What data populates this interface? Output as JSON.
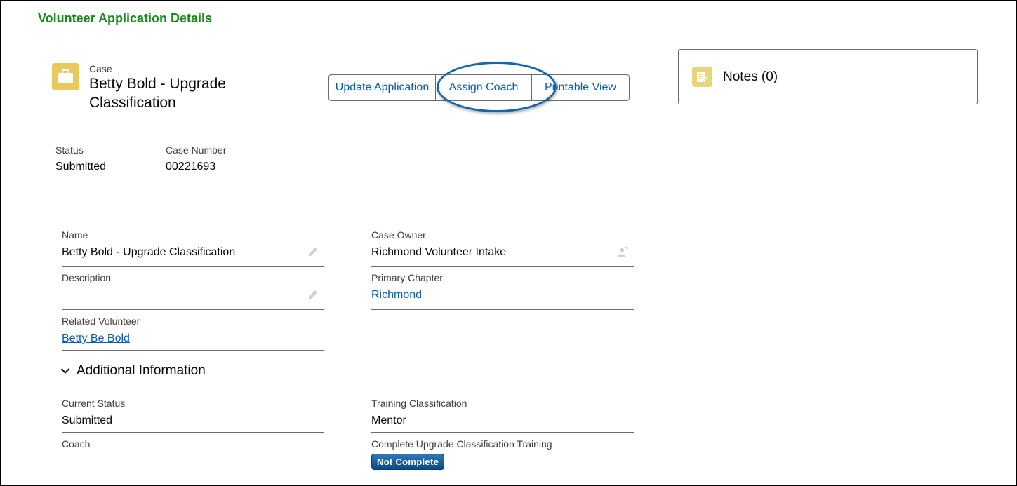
{
  "page": {
    "title": "Volunteer Application Details"
  },
  "record": {
    "object_label": "Case",
    "title": "Betty Bold - Upgrade Classification",
    "icon": "briefcase-icon",
    "icon_color": "#e8c95a"
  },
  "actions": {
    "update_application": "Update Application",
    "assign_coach": "Assign Coach",
    "printable_view": "Printable View"
  },
  "notes": {
    "label": "Notes (0)",
    "icon": "notes-icon"
  },
  "highlights": {
    "status_label": "Status",
    "status_value": "Submitted",
    "case_number_label": "Case Number",
    "case_number_value": "00221693"
  },
  "details": {
    "name_label": "Name",
    "name_value": "Betty Bold - Upgrade Classification",
    "case_owner_label": "Case Owner",
    "case_owner_value": "Richmond Volunteer Intake",
    "description_label": "Description",
    "description_value": "",
    "primary_chapter_label": "Primary Chapter",
    "primary_chapter_value": "Richmond",
    "related_volunteer_label": "Related Volunteer",
    "related_volunteer_value": "Betty Be Bold"
  },
  "additional": {
    "header": "Additional Information",
    "current_status_label": "Current Status",
    "current_status_value": "Submitted",
    "training_classification_label": "Training Classification",
    "training_classification_value": "Mentor",
    "coach_label": "Coach",
    "coach_value": "",
    "upgrade_training_label": "Complete Upgrade Classification Training",
    "upgrade_training_value": "Not Complete"
  },
  "colors": {
    "title_green": "#1a8a1a",
    "link_blue": "#0b5cab",
    "highlight_ring": "#1565a8"
  }
}
